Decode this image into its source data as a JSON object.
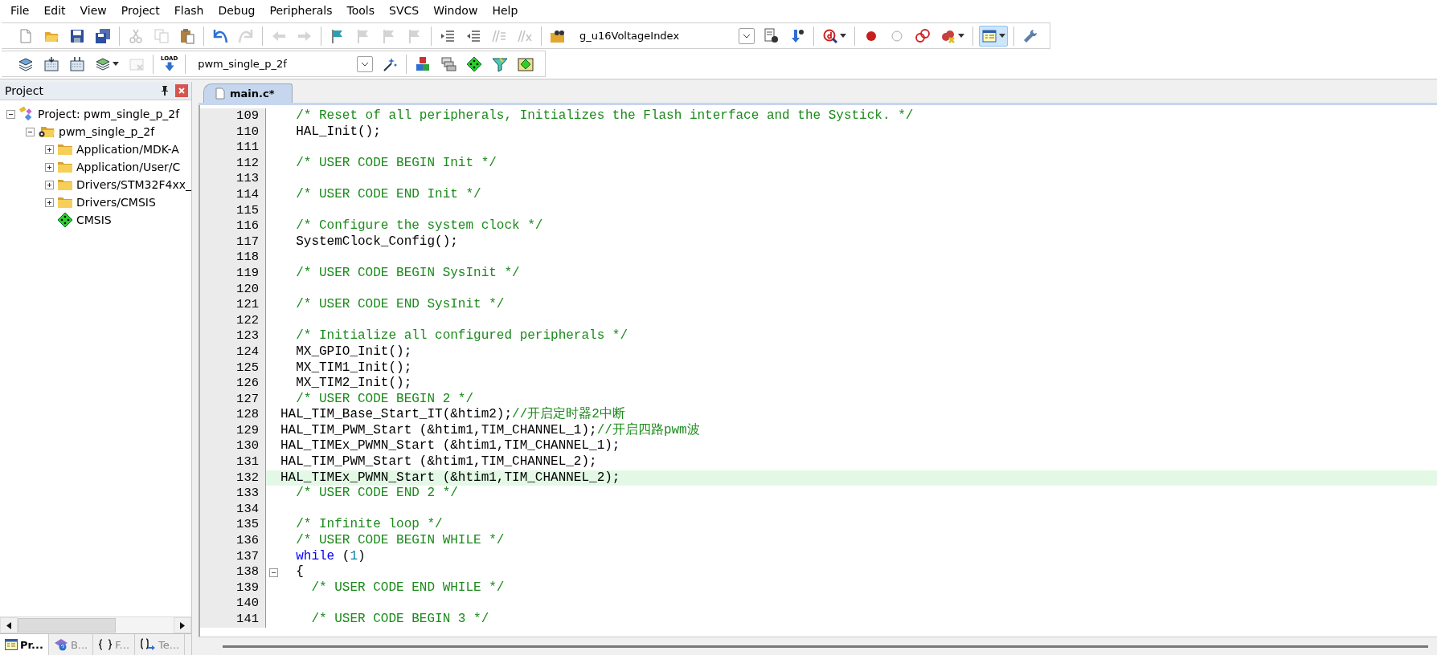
{
  "menu_bar": [
    "File",
    "Edit",
    "View",
    "Project",
    "Flash",
    "Debug",
    "Peripherals",
    "Tools",
    "SVCS",
    "Window",
    "Help"
  ],
  "toolbar_1": {
    "groups": [
      [
        {
          "kind": "button",
          "disabled": false,
          "pressed": false
        },
        {
          "kind": "button",
          "disabled": false,
          "pressed": false
        },
        {
          "kind": "button",
          "disabled": false,
          "pressed": false
        },
        {
          "kind": "button",
          "disabled": false,
          "pressed": false
        }
      ],
      [
        {
          "kind": "button",
          "disabled": true,
          "pressed": false
        },
        {
          "kind": "button",
          "disabled": true,
          "pressed": false
        },
        {
          "kind": "button",
          "disabled": false,
          "pressed": false
        }
      ],
      [
        {
          "kind": "button",
          "disabled": false,
          "pressed": false
        },
        {
          "kind": "button",
          "disabled": true,
          "pressed": false
        }
      ],
      [
        {
          "kind": "button",
          "disabled": true,
          "pressed": false
        },
        {
          "kind": "button",
          "disabled": true,
          "pressed": false
        }
      ],
      [
        {
          "kind": "button",
          "disabled": false,
          "pressed": false
        },
        {
          "kind": "button",
          "disabled": true,
          "pressed": false
        },
        {
          "kind": "button",
          "disabled": true,
          "pressed": false
        },
        {
          "kind": "button",
          "disabled": true,
          "pressed": false
        }
      ],
      [
        {
          "kind": "button",
          "disabled": false,
          "pressed": false
        },
        {
          "kind": "button",
          "disabled": false,
          "pressed": false
        },
        {
          "kind": "button",
          "disabled": true,
          "pressed": false
        },
        {
          "kind": "button",
          "disabled": true,
          "pressed": false
        }
      ],
      [
        {
          "kind": "button",
          "disabled": false,
          "pressed": false
        },
        {
          "kind": "combo",
          "value": "g_u16VoltageIndex"
        },
        {
          "kind": "button",
          "disabled": false,
          "pressed": false
        },
        {
          "kind": "button",
          "disabled": false,
          "pressed": false
        }
      ],
      [
        {
          "kind": "button",
          "disabled": false,
          "pressed": false
        }
      ],
      [
        {
          "kind": "button",
          "disabled": false,
          "pressed": false
        },
        {
          "kind": "button",
          "disabled": false,
          "pressed": false
        },
        {
          "kind": "button",
          "disabled": false,
          "pressed": false
        },
        {
          "kind": "button",
          "disabled": false,
          "pressed": false
        }
      ],
      [
        {
          "kind": "button",
          "disabled": false,
          "pressed": true
        }
      ],
      [
        {
          "kind": "button",
          "disabled": false,
          "pressed": false
        }
      ]
    ]
  },
  "toolbar_2": {
    "groups": [
      [
        {
          "kind": "button",
          "disabled": false,
          "pressed": false
        },
        {
          "kind": "button",
          "disabled": false,
          "pressed": false
        },
        {
          "kind": "button",
          "disabled": false,
          "pressed": false
        },
        {
          "kind": "button",
          "disabled": false,
          "pressed": false
        },
        {
          "kind": "button",
          "disabled": true,
          "pressed": false
        }
      ],
      [
        {
          "kind": "button",
          "label": "LOAD",
          "disabled": false,
          "pressed": false
        }
      ],
      [
        {
          "kind": "combo",
          "value": "pwm_single_p_2f"
        },
        {
          "kind": "button",
          "disabled": false,
          "pressed": false
        }
      ],
      [
        {
          "kind": "button",
          "disabled": false,
          "pressed": false
        },
        {
          "kind": "button",
          "disabled": false,
          "pressed": false
        },
        {
          "kind": "button",
          "disabled": false,
          "pressed": false
        },
        {
          "kind": "button",
          "disabled": false,
          "pressed": false
        },
        {
          "kind": "button",
          "disabled": false,
          "pressed": false
        }
      ]
    ]
  },
  "project_panel": {
    "title": "Project",
    "tree": [
      {
        "kind": "project",
        "label": "Project: pwm_single_p_2f",
        "expanded": true,
        "children": [
          {
            "kind": "target",
            "label": "pwm_single_p_2f",
            "expanded": true,
            "children": [
              {
                "kind": "folder",
                "label": "Application/MDK-A",
                "expanded": false
              },
              {
                "kind": "folder",
                "label": "Application/User/C",
                "expanded": false
              },
              {
                "kind": "folder",
                "label": "Drivers/STM32F4xx_",
                "expanded": false
              },
              {
                "kind": "folder",
                "label": "Drivers/CMSIS",
                "expanded": false
              },
              {
                "kind": "component",
                "label": "CMSIS"
              }
            ]
          }
        ]
      }
    ],
    "tabs": [
      {
        "kind": "project",
        "label": "Pr...",
        "selected": true
      },
      {
        "kind": "books",
        "label": "B...",
        "selected": false
      },
      {
        "kind": "functions",
        "label": "F...",
        "selected": false
      },
      {
        "kind": "templates",
        "label": "Te...",
        "selected": false
      }
    ]
  },
  "editor": {
    "tabs": [
      {
        "label": "main.c*",
        "selected": true
      }
    ],
    "lines": [
      {
        "number": "109",
        "highlighted": false,
        "fold": false,
        "segments": [
          {
            "kind": "comment",
            "text": "  /* Reset of all peripherals, Initializes the Flash interface and the Systick. */"
          }
        ]
      },
      {
        "number": "110",
        "highlighted": false,
        "fold": false,
        "segments": [
          {
            "kind": "plain",
            "text": "  HAL_Init();"
          }
        ]
      },
      {
        "number": "111",
        "highlighted": false,
        "fold": false
      },
      {
        "number": "112",
        "highlighted": false,
        "fold": false,
        "segments": [
          {
            "kind": "comment",
            "text": "  /* USER CODE BEGIN Init */"
          }
        ]
      },
      {
        "number": "113",
        "highlighted": false,
        "fold": false
      },
      {
        "number": "114",
        "highlighted": false,
        "fold": false,
        "segments": [
          {
            "kind": "comment",
            "text": "  /* USER CODE END Init */"
          }
        ]
      },
      {
        "number": "115",
        "highlighted": false,
        "fold": false
      },
      {
        "number": "116",
        "highlighted": false,
        "fold": false,
        "segments": [
          {
            "kind": "comment",
            "text": "  /* Configure the system clock */"
          }
        ]
      },
      {
        "number": "117",
        "highlighted": false,
        "fold": false,
        "segments": [
          {
            "kind": "plain",
            "text": "  SystemClock_Config();"
          }
        ]
      },
      {
        "number": "118",
        "highlighted": false,
        "fold": false
      },
      {
        "number": "119",
        "highlighted": false,
        "fold": false,
        "segments": [
          {
            "kind": "comment",
            "text": "  /* USER CODE BEGIN SysInit */"
          }
        ]
      },
      {
        "number": "120",
        "highlighted": false,
        "fold": false
      },
      {
        "number": "121",
        "highlighted": false,
        "fold": false,
        "segments": [
          {
            "kind": "comment",
            "text": "  /* USER CODE END SysInit */"
          }
        ]
      },
      {
        "number": "122",
        "highlighted": false,
        "fold": false
      },
      {
        "number": "123",
        "highlighted": false,
        "fold": false,
        "segments": [
          {
            "kind": "comment",
            "text": "  /* Initialize all configured peripherals */"
          }
        ]
      },
      {
        "number": "124",
        "highlighted": false,
        "fold": false,
        "segments": [
          {
            "kind": "plain",
            "text": "  MX_GPIO_Init();"
          }
        ]
      },
      {
        "number": "125",
        "highlighted": false,
        "fold": false,
        "segments": [
          {
            "kind": "plain",
            "text": "  MX_TIM1_Init();"
          }
        ]
      },
      {
        "number": "126",
        "highlighted": false,
        "fold": false,
        "segments": [
          {
            "kind": "plain",
            "text": "  MX_TIM2_Init();"
          }
        ]
      },
      {
        "number": "127",
        "highlighted": false,
        "fold": false,
        "segments": [
          {
            "kind": "comment",
            "text": "  /* USER CODE BEGIN 2 */"
          }
        ]
      },
      {
        "number": "128",
        "highlighted": false,
        "fold": false,
        "segments": [
          {
            "kind": "plain",
            "text": "HAL_TIM_Base_Start_IT(&htim2);"
          },
          {
            "kind": "comment",
            "text": "//开启定时器2中断"
          }
        ]
      },
      {
        "number": "129",
        "highlighted": false,
        "fold": false,
        "segments": [
          {
            "kind": "plain",
            "text": "HAL_TIM_PWM_Start (&htim1,TIM_CHANNEL_1);"
          },
          {
            "kind": "comment",
            "text": "//开启四路pwm波"
          }
        ]
      },
      {
        "number": "130",
        "highlighted": false,
        "fold": false,
        "segments": [
          {
            "kind": "plain",
            "text": "HAL_TIMEx_PWMN_Start (&htim1,TIM_CHANNEL_1);"
          }
        ]
      },
      {
        "number": "131",
        "highlighted": false,
        "fold": false,
        "segments": [
          {
            "kind": "plain",
            "text": "HAL_TIM_PWM_Start (&htim1,TIM_CHANNEL_2);"
          }
        ]
      },
      {
        "number": "132",
        "highlighted": true,
        "fold": false,
        "segments": [
          {
            "kind": "plain",
            "text": "HAL_TIMEx_PWMN_Start (&htim1,TIM_CHANNEL_2);"
          }
        ]
      },
      {
        "number": "133",
        "highlighted": false,
        "fold": false,
        "segments": [
          {
            "kind": "comment",
            "text": "  /* USER CODE END 2 */"
          }
        ]
      },
      {
        "number": "134",
        "highlighted": false,
        "fold": false
      },
      {
        "number": "135",
        "highlighted": false,
        "fold": false,
        "segments": [
          {
            "kind": "comment",
            "text": "  /* Infinite loop */"
          }
        ]
      },
      {
        "number": "136",
        "highlighted": false,
        "fold": false,
        "segments": [
          {
            "kind": "comment",
            "text": "  /* USER CODE BEGIN WHILE */"
          }
        ]
      },
      {
        "number": "137",
        "highlighted": false,
        "fold": false,
        "segments": [
          {
            "kind": "keyword",
            "text": "  while"
          },
          {
            "kind": "plain",
            "text": " ("
          },
          {
            "kind": "number",
            "text": "1"
          },
          {
            "kind": "plain",
            "text": ")"
          }
        ]
      },
      {
        "number": "138",
        "highlighted": false,
        "fold": true,
        "segments": [
          {
            "kind": "plain",
            "text": "  {"
          }
        ]
      },
      {
        "number": "139",
        "highlighted": false,
        "fold": false,
        "segments": [
          {
            "kind": "comment",
            "text": "    /* USER CODE END WHILE */"
          }
        ]
      },
      {
        "number": "140",
        "highlighted": false,
        "fold": false
      },
      {
        "number": "141",
        "highlighted": false,
        "fold": false,
        "segments": [
          {
            "kind": "comment",
            "text": "    /* USER CODE BEGIN 3 */"
          }
        ]
      }
    ]
  }
}
